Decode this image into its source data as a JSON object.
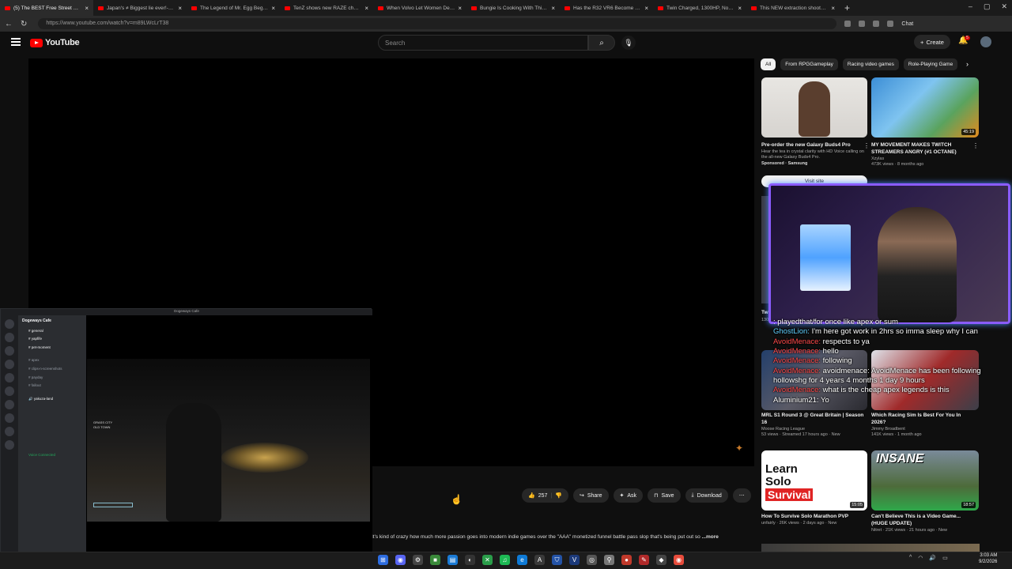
{
  "browser": {
    "tabs": [
      {
        "label": "(5) The BEST Free Street Raci",
        "active": true
      },
      {
        "label": "Japan's ≠ Biggest lie ever!-280 H"
      },
      {
        "label": "The Legend of Mr. Egg Begins"
      },
      {
        "label": "TenZ shows new RAZE changes"
      },
      {
        "label": "When Volvo Let Women Design a"
      },
      {
        "label": "Bungie Is Cooking With This..."
      },
      {
        "label": "Has the R32 VR6 Become TOO Co"
      },
      {
        "label": "Twin Charged, 1300HP, No Lag."
      },
      {
        "label": "This NEW extraction shooter is W"
      }
    ],
    "url": "https://www.youtube.com/watch?v=m89LWcLrT38",
    "chat_label": "Chat"
  },
  "youtube": {
    "logo_text": "YouTube",
    "search_placeholder": "Search",
    "create_label": "Create",
    "notification_count": "5"
  },
  "actions": {
    "likes": "257",
    "share": "Share",
    "ask": "Ask",
    "save": "Save",
    "download": "Download"
  },
  "description": {
    "text": "It's kind of crazy how much more passion goes into modern indie games over the \"AAA\" monetized funnel battle pass slop that's being put out so",
    "more": "...more"
  },
  "discord": {
    "window_title": "Dogeways Cafe",
    "server_name": "Dogeways Cafe",
    "channels": [
      {
        "name": "general",
        "bold": true
      },
      {
        "name": "yapfife",
        "bold": true
      },
      {
        "name": "pet-moment",
        "bold": true
      },
      {
        "name": "apex",
        "bold": false
      },
      {
        "name": "clips-n-screenshots",
        "bold": false
      },
      {
        "name": "payday",
        "bold": false
      },
      {
        "name": "fallout",
        "bold": false
      },
      {
        "name": "yakuza-land",
        "bold": true
      }
    ],
    "hud_location": "GRASS CITY\nOLD TOWN",
    "voice_status": "Voice Connected",
    "user": "Jeesee (Hollow)"
  },
  "chips": [
    "All",
    "From RPGGameplay",
    "Racing video games",
    "Role-Playing Game"
  ],
  "sidebar": {
    "ad": {
      "title": "Pre-order the new Galaxy Buds4 Pro",
      "desc": "Hear the tea in crystal clarity with HD Voice calling on the all-new Galaxy Buds4 Pro.",
      "sponsor": "Sponsored · Samsung",
      "cta": "Visit site"
    },
    "videos": [
      {
        "title": "MY MOVEMENT MAKES TWITCH STREAMERS ANGRY (#1 OCTANE)",
        "channel": "Xzylas",
        "meta": "473K views · 8 months ago",
        "duration": "45:19"
      },
      {
        "title": "MRL S1 Round 3 @ Great Britain | Season 16",
        "channel": "Moose Racing League",
        "meta": "53 views · Streamed 17 hours ago · New",
        "duration": ""
      },
      {
        "title": "Which Racing Sim Is Best For You In 2026?",
        "channel": "Jimmy Broadbent",
        "meta": "141K views · 1 month ago",
        "duration": ""
      },
      {
        "title": "How To Survive Solo Marathon PVP",
        "channel": "unfairly",
        "meta": "26K views · 2 days ago · New",
        "duration": "15:05",
        "thumb_text": "Learn\nSolo",
        "thumb_red": "Survival"
      },
      {
        "title": "Can't Believe This is a Video Game... (HUGE UPDATE)",
        "channel": "Nitret",
        "meta": "21K views · 21 hours ago · New",
        "duration": "18:57",
        "thumb_text": "INSANE"
      }
    ],
    "partial_label": "Twi",
    "partial_meta": "130"
  },
  "chat_lines": [
    {
      "user": "",
      "text": ": playedthat/for once like apex or sum"
    },
    {
      "user": "GhostLion:",
      "text": " I'm here got work in 2hrs so imma sleep why I can"
    },
    {
      "user": "AvoidMenace:",
      "text": " respects to ya"
    },
    {
      "user": "AvoidMenace:",
      "text": " hello"
    },
    {
      "user": "AvoidMenace:",
      "text": " following"
    },
    {
      "user": "AvoidMenace:",
      "text": " avoidmenace: AvoidMenace has been following hollowshg for 4 years 4 months 1 day 9 hours"
    },
    {
      "user": "AvoidMenace:",
      "text": " what is the cheap apex legends is this"
    },
    {
      "user": "Aluminium21:",
      "text": " Yo"
    }
  ],
  "taskbar": {
    "time": "3:03 AM",
    "date": "9/2/2026"
  },
  "colors": {
    "youtube_red": "#ff0000",
    "cam_border": "#8a5cff",
    "chat_user": "#5fd0ff"
  }
}
